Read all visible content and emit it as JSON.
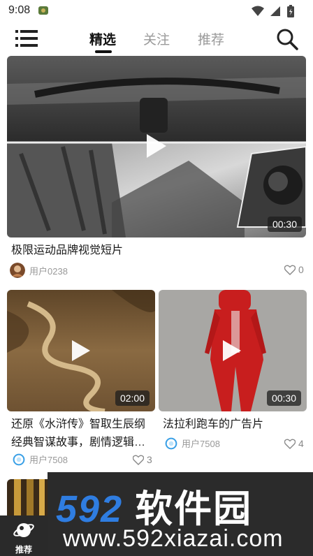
{
  "status_bar": {
    "time": "9:08"
  },
  "nav": {
    "tabs": [
      {
        "label": "精选",
        "active": true
      },
      {
        "label": "关注",
        "active": false
      },
      {
        "label": "推荐",
        "active": false
      }
    ]
  },
  "feed": [
    {
      "title": "极限运动品牌视觉短片",
      "duration": "00:30",
      "user": "用户0238",
      "likes": "0"
    },
    {
      "title": "还原《水浒传》智取生辰纲经典智谋故事，剧情逻辑…",
      "duration": "02:00",
      "user": "用户7508",
      "likes": "3"
    },
    {
      "title": "法拉利跑车的广告片",
      "duration": "00:30",
      "user": "用户7508",
      "likes": "4"
    }
  ],
  "bottom": {
    "recommend_label": "推荐"
  },
  "watermark": {
    "brand_digits": "592",
    "brand_text": "软件园",
    "url": "www.592xiazai.com"
  },
  "colors": {
    "watermark_blue": "#2f7de1",
    "text_dark": "#1a1a1a",
    "muted": "#999999"
  }
}
